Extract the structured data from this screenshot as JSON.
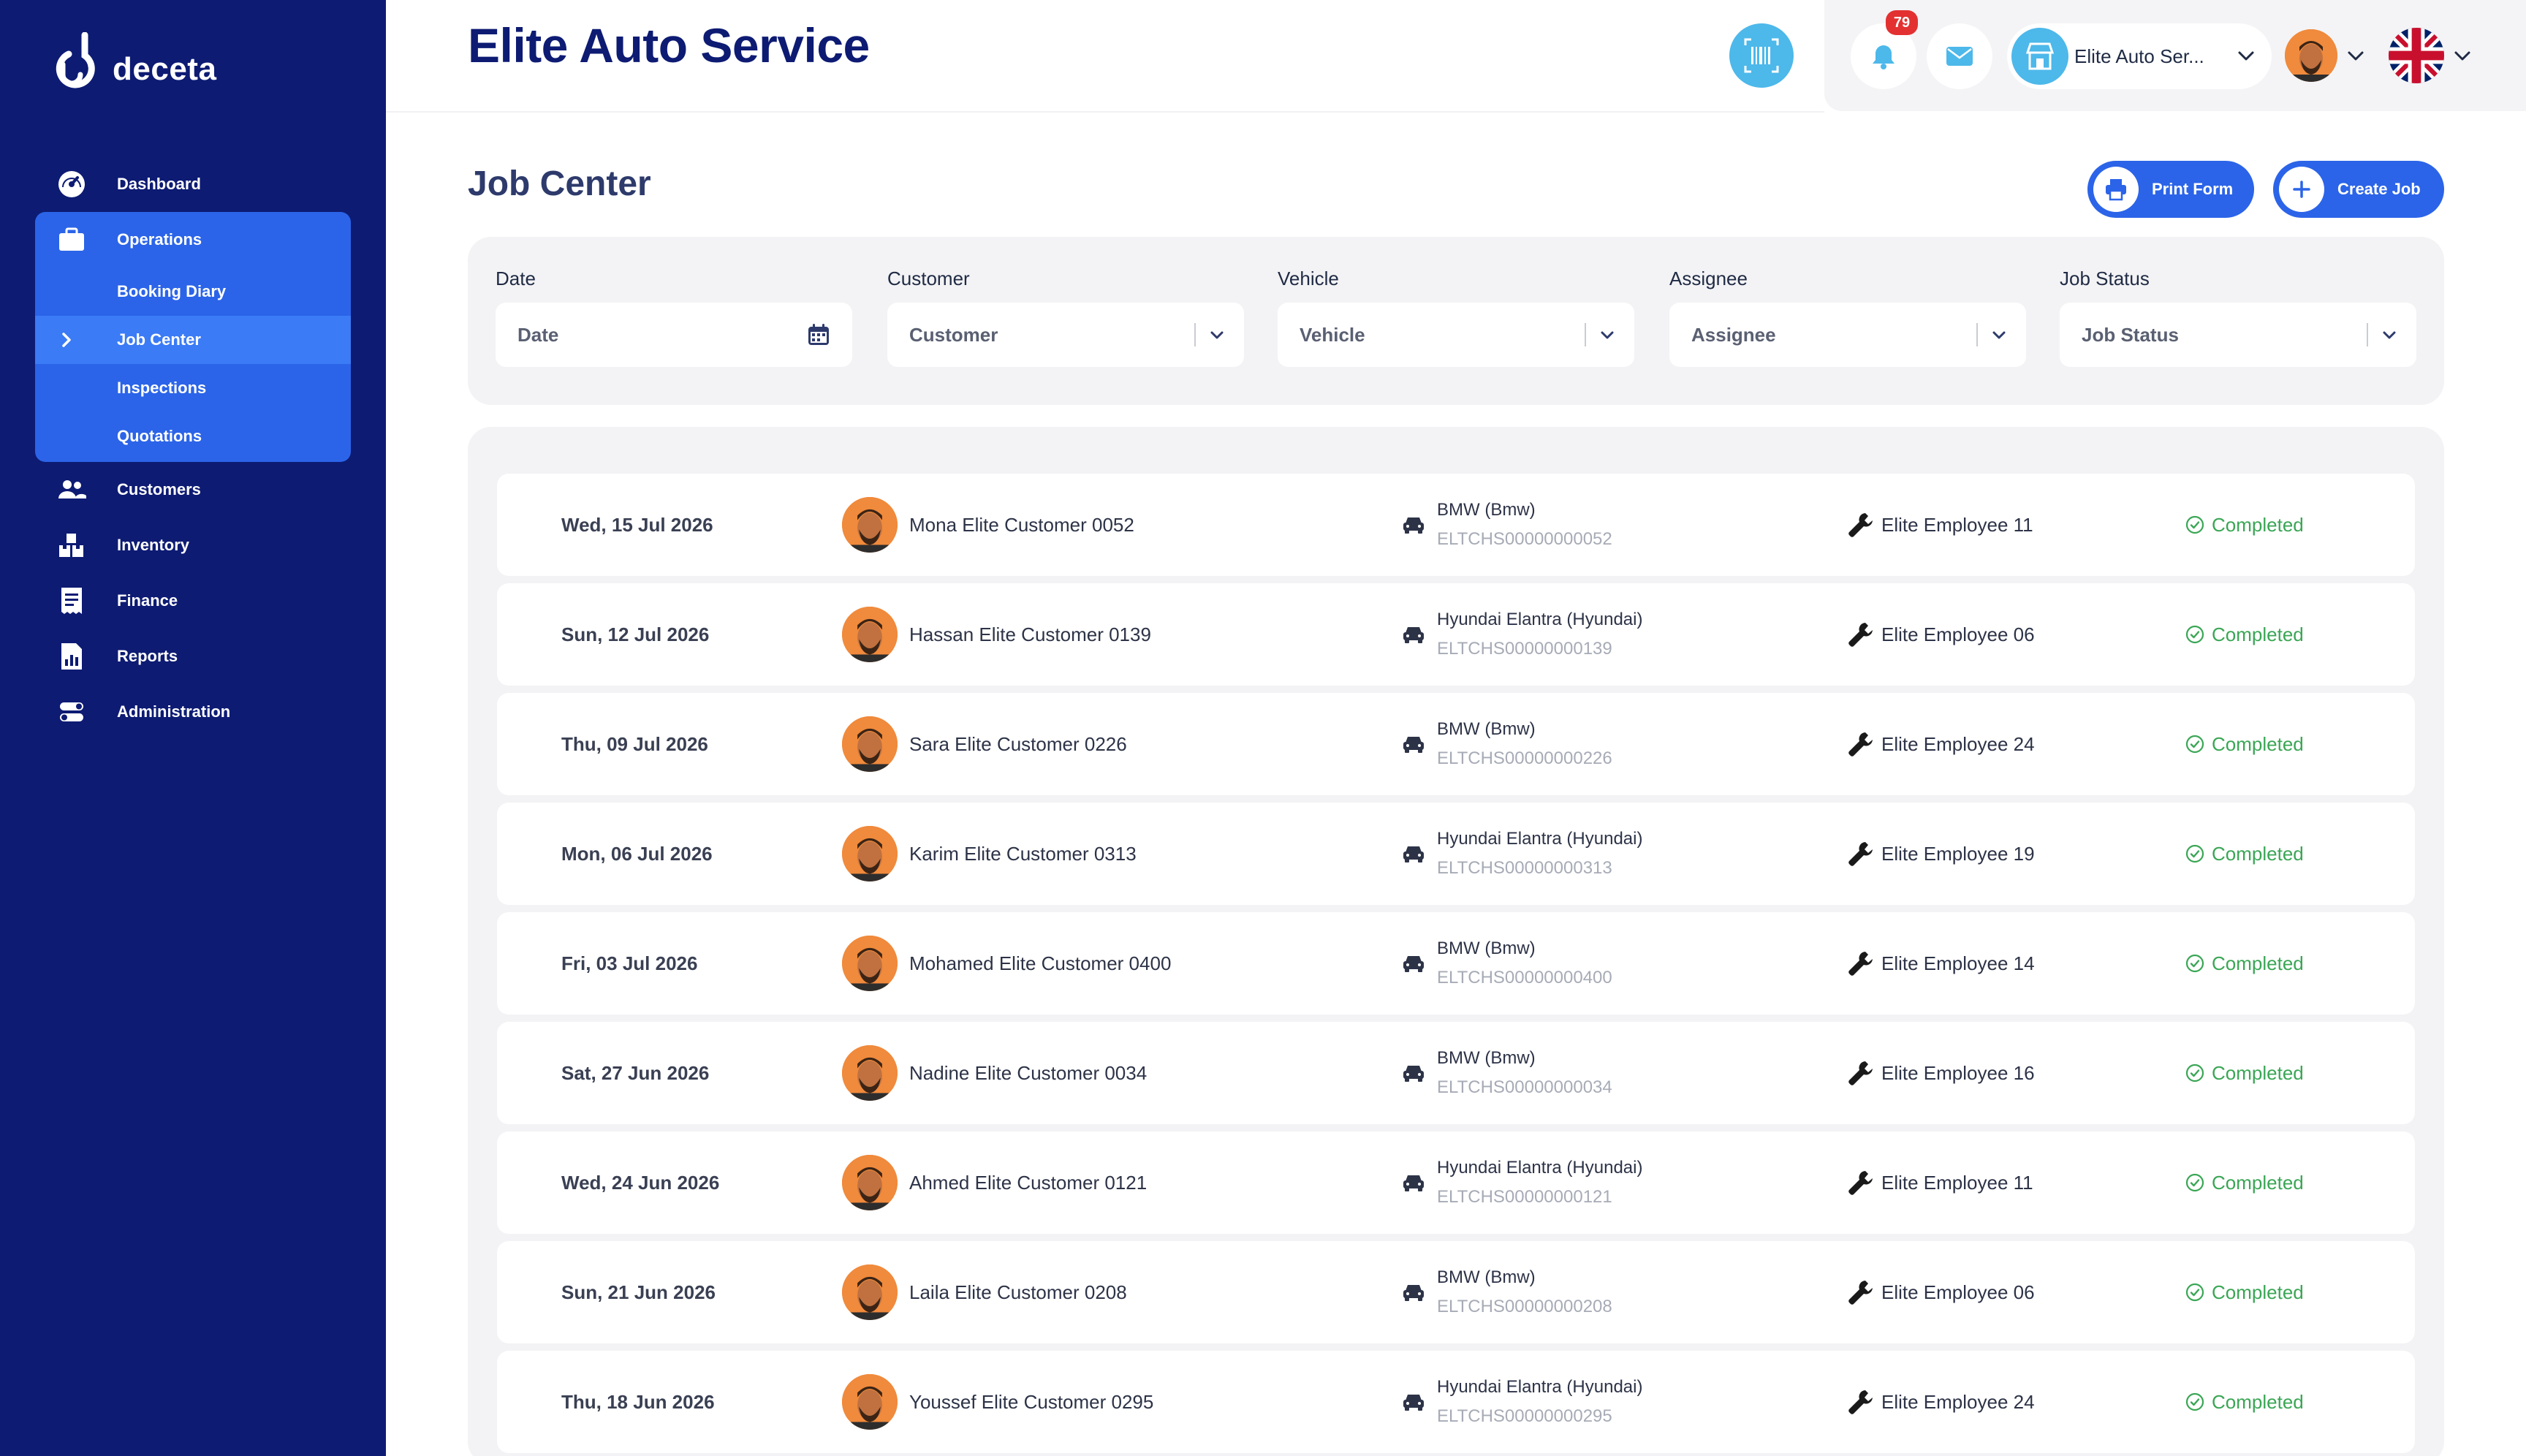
{
  "brand": {
    "name": "deceta"
  },
  "header": {
    "title": "Elite Auto Service",
    "notification_count": "79",
    "store_name": "Elite Auto Ser..."
  },
  "sidebar": {
    "items": [
      {
        "key": "dashboard",
        "label": "Dashboard",
        "icon": "dashboard-gauge-icon"
      },
      {
        "key": "operations",
        "label": "Operations",
        "icon": "briefcase-icon"
      },
      {
        "key": "customers",
        "label": "Customers",
        "icon": "people-icon"
      },
      {
        "key": "inventory",
        "label": "Inventory",
        "icon": "boxes-icon"
      },
      {
        "key": "finance",
        "label": "Finance",
        "icon": "receipt-icon"
      },
      {
        "key": "reports",
        "label": "Reports",
        "icon": "report-chart-icon"
      },
      {
        "key": "administration",
        "label": "Administration",
        "icon": "toggles-icon"
      }
    ],
    "operations_sub": [
      {
        "label": "Booking Diary"
      },
      {
        "label": "Job Center"
      },
      {
        "label": "Inspections"
      },
      {
        "label": "Quotations"
      }
    ]
  },
  "page": {
    "title": "Job Center",
    "print_label": "Print Form",
    "create_label": "Create Job"
  },
  "filters": {
    "date": {
      "label": "Date",
      "placeholder": "Date"
    },
    "customer": {
      "label": "Customer",
      "placeholder": "Customer"
    },
    "vehicle": {
      "label": "Vehicle",
      "placeholder": "Vehicle"
    },
    "assignee": {
      "label": "Assignee",
      "placeholder": "Assignee"
    },
    "status": {
      "label": "Job Status",
      "placeholder": "Job Status"
    }
  },
  "jobs": [
    {
      "date": "Wed, 15 Jul 2026",
      "customer": "Mona Elite Customer 0052",
      "vehicle": "BMW (Bmw)",
      "code": "ELTCHS00000000052",
      "assignee": "Elite Employee 11",
      "status": "Completed"
    },
    {
      "date": "Sun, 12 Jul 2026",
      "customer": "Hassan Elite Customer 0139",
      "vehicle": "Hyundai Elantra (Hyundai)",
      "code": "ELTCHS00000000139",
      "assignee": "Elite Employee 06",
      "status": "Completed"
    },
    {
      "date": "Thu, 09 Jul 2026",
      "customer": "Sara Elite Customer 0226",
      "vehicle": "BMW (Bmw)",
      "code": "ELTCHS00000000226",
      "assignee": "Elite Employee 24",
      "status": "Completed"
    },
    {
      "date": "Mon, 06 Jul 2026",
      "customer": "Karim Elite Customer 0313",
      "vehicle": "Hyundai Elantra (Hyundai)",
      "code": "ELTCHS00000000313",
      "assignee": "Elite Employee 19",
      "status": "Completed"
    },
    {
      "date": "Fri, 03 Jul 2026",
      "customer": "Mohamed Elite Customer 0400",
      "vehicle": "BMW (Bmw)",
      "code": "ELTCHS00000000400",
      "assignee": "Elite Employee 14",
      "status": "Completed"
    },
    {
      "date": "Sat, 27 Jun 2026",
      "customer": "Nadine Elite Customer 0034",
      "vehicle": "BMW (Bmw)",
      "code": "ELTCHS00000000034",
      "assignee": "Elite Employee 16",
      "status": "Completed"
    },
    {
      "date": "Wed, 24 Jun 2026",
      "customer": "Ahmed Elite Customer 0121",
      "vehicle": "Hyundai Elantra (Hyundai)",
      "code": "ELTCHS00000000121",
      "assignee": "Elite Employee 11",
      "status": "Completed"
    },
    {
      "date": "Sun, 21 Jun 2026",
      "customer": "Laila Elite Customer 0208",
      "vehicle": "BMW (Bmw)",
      "code": "ELTCHS00000000208",
      "assignee": "Elite Employee 06",
      "status": "Completed"
    },
    {
      "date": "Thu, 18 Jun 2026",
      "customer": "Youssef Elite Customer 0295",
      "vehicle": "Hyundai Elantra (Hyundai)",
      "code": "ELTCHS00000000295",
      "assignee": "Elite Employee 24",
      "status": "Completed"
    }
  ],
  "colors": {
    "sidebar_bg": "#0d1b73",
    "accent": "#2b64e8",
    "active_sub": "#3b7bf5",
    "completed": "#3aa655",
    "badge": "#e33131",
    "light_blue": "#4db8ea"
  }
}
